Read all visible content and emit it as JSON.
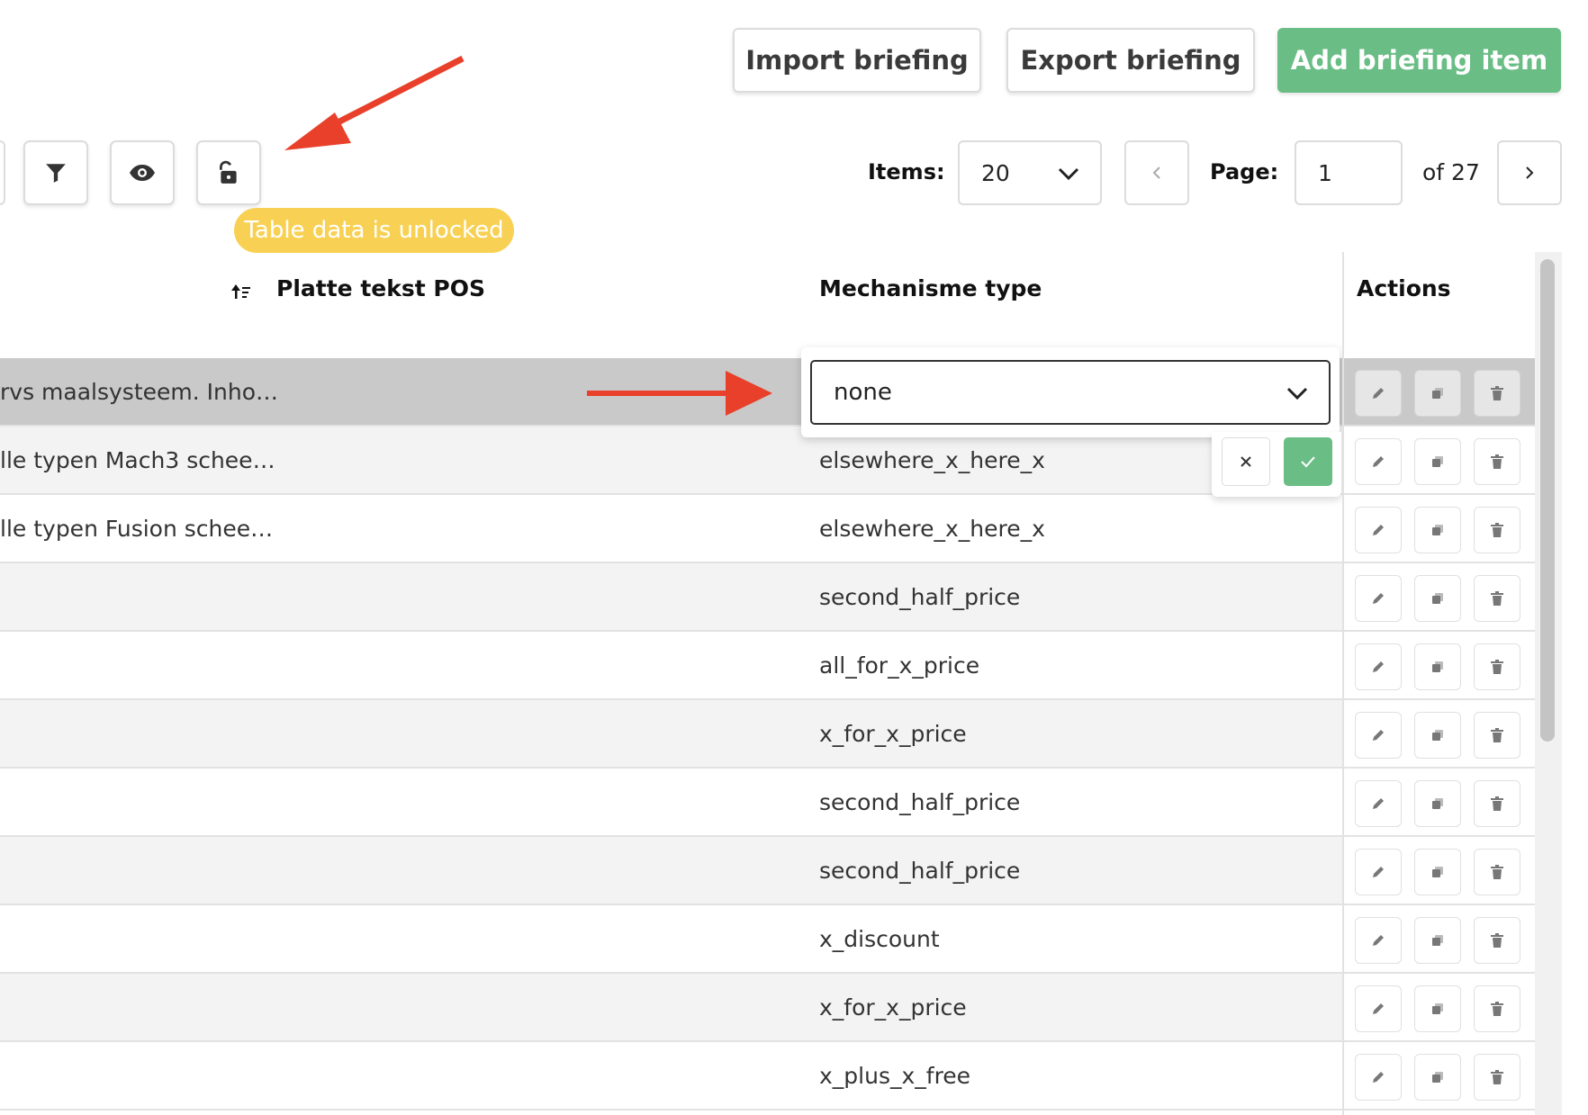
{
  "header": {
    "import_label": "Import briefing",
    "export_label": "Export briefing",
    "add_label": "Add briefing item"
  },
  "toolbar": {
    "lock_status": "Table data is unlocked"
  },
  "pagination": {
    "items_label": "Items:",
    "items_value": "20",
    "page_label": "Page:",
    "page_value": "1",
    "of_text": "of 27"
  },
  "columns": {
    "pos": "Platte tekst POS",
    "mech": "Mechanisme type",
    "actions": "Actions"
  },
  "rows": [
    {
      "pos": "rvs maalsysteem. Inho…",
      "mech": ""
    },
    {
      "pos": "lle typen Mach3 schee…",
      "mech": "elsewhere_x_here_x"
    },
    {
      "pos": "lle typen Fusion schee…",
      "mech": "elsewhere_x_here_x"
    },
    {
      "pos": "",
      "mech": "second_half_price"
    },
    {
      "pos": "",
      "mech": "all_for_x_price"
    },
    {
      "pos": "",
      "mech": "x_for_x_price"
    },
    {
      "pos": "",
      "mech": "second_half_price"
    },
    {
      "pos": "",
      "mech": "second_half_price"
    },
    {
      "pos": "",
      "mech": "x_discount"
    },
    {
      "pos": "",
      "mech": "x_for_x_price"
    },
    {
      "pos": "",
      "mech": "x_plus_x_free"
    }
  ],
  "editor": {
    "value": "none"
  },
  "colors": {
    "primary": "#69bd85",
    "badge": "#f8d154",
    "annotation_arrow": "#e8402a"
  }
}
